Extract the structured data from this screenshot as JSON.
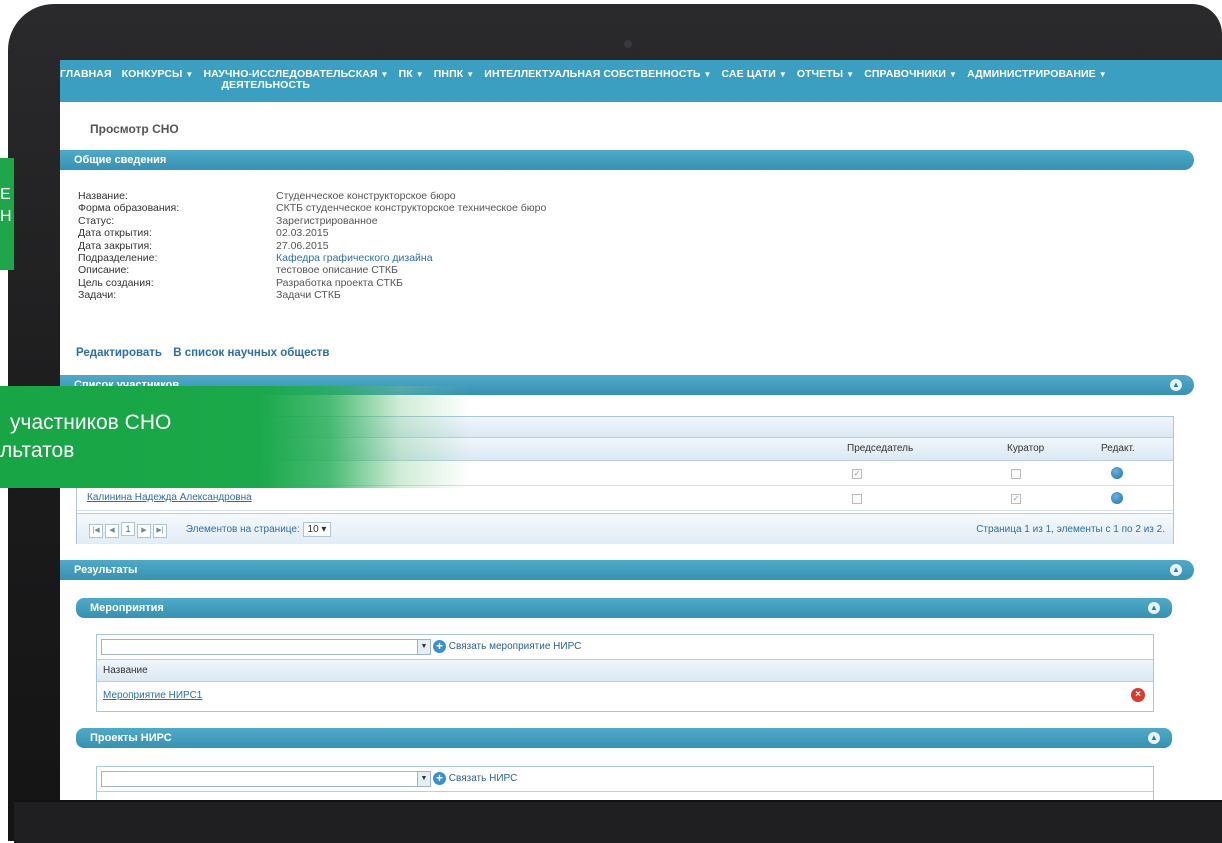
{
  "nav": [
    {
      "label": "ГЛАВНАЯ",
      "caret": false
    },
    {
      "label": "КОНКУРСЫ",
      "caret": true
    },
    {
      "label": "НАУЧНО-ИССЛЕДОВАТЕЛЬСКАЯ",
      "label2": "ДЕЯТЕЛЬНОСТЬ",
      "caret": true
    },
    {
      "label": "ПК",
      "caret": true
    },
    {
      "label": "ПНПК",
      "caret": true
    },
    {
      "label": "ИНТЕЛЛЕКТУАЛЬНАЯ СОБСТВЕННОСТЬ",
      "caret": true
    },
    {
      "label": "САЕ ЦАТИ",
      "caret": true
    },
    {
      "label": "ОТЧЕТЫ",
      "caret": true
    },
    {
      "label": "СПРАВОЧНИКИ",
      "caret": true
    },
    {
      "label": "АДМИНИСТРИРОВАНИЕ",
      "caret": true
    }
  ],
  "page_title": "Просмотр СНО",
  "general": {
    "header": "Общие сведения",
    "rows": [
      {
        "label": "Название:",
        "value": "Студенческое конструкторское бюро"
      },
      {
        "label": "Форма образования:",
        "value": "СКТБ студенческое конструкторское техническое бюро"
      },
      {
        "label": "Статус:",
        "value": "Зарегистрированное"
      },
      {
        "label": "Дата открытия:",
        "value": "02.03.2015"
      },
      {
        "label": "Дата закрытия:",
        "value": "27.06.2015"
      },
      {
        "label": "Подразделение:",
        "value": "Кафедра графического дизайна"
      },
      {
        "label": "Описание:",
        "value": "тестовое описание СТКБ"
      },
      {
        "label": "Цель создания:",
        "value": "Разработка проекта СТКБ"
      },
      {
        "label": "Задачи:",
        "value": "Задачи СТКБ"
      }
    ]
  },
  "actions": {
    "edit": "Редактировать",
    "back": "В список научных обществ"
  },
  "participants": {
    "header": "Список участников",
    "columns": [
      "Председатель",
      "Куратор",
      "Редакт."
    ],
    "rows": [
      {
        "name": "",
        "chair": true,
        "curator": false
      },
      {
        "name": "Калинина Надежда Александровна",
        "chair": false,
        "curator": true
      }
    ],
    "pager": {
      "page": "1",
      "per_page_label": "Элементов на странице:",
      "per_page": "10",
      "status": "Страница 1 из 1, элементы с 1 по 2 из 2."
    }
  },
  "results": {
    "header": "Результаты",
    "events": {
      "header": "Мероприятия",
      "link_label": "Связать мероприятие НИРС",
      "column": "Название",
      "rows": [
        "Мероприятие НИРС1"
      ]
    },
    "projects": {
      "header": "Проекты НИРС",
      "link_label": "Связать НИРС"
    }
  },
  "overlay": {
    "left_letters": [
      "Е",
      "Н"
    ],
    "banner_line1": "участников СНО",
    "banner_line2": "льтатов"
  },
  "colors": {
    "nav": "#3a9fc1",
    "overlay": "#1fa64a",
    "link": "#2c6fa6"
  }
}
